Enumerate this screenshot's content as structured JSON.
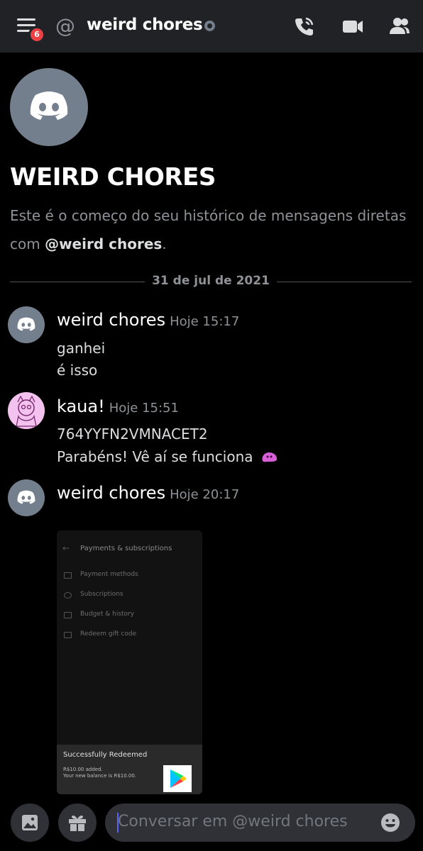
{
  "header": {
    "menu_badge": "6",
    "channel_name": "weird chores"
  },
  "intro": {
    "title": "WEIRD CHORES",
    "text_prefix": "Este é o começo do seu histórico de mensagens diretas com ",
    "mention": "@weird chores",
    "text_suffix": "."
  },
  "divider_date": "31 de jul de 2021",
  "messages": [
    {
      "author": "weird chores",
      "time": "Hoje 15:17",
      "lines": [
        "ganhei",
        "é isso"
      ]
    },
    {
      "author": "kaua!",
      "time": "Hoje 15:51",
      "lines": [
        "764YYFN2VMNACET2",
        "Parabéns! Vê aí se funciona"
      ]
    },
    {
      "author": "weird chores",
      "time": "Hoje 20:17",
      "lines": []
    }
  ],
  "attachment": {
    "title": "Payments & subscriptions",
    "items": [
      "Payment methods",
      "Subscriptions",
      "Budget & history",
      "Redeem gift code"
    ],
    "toast_title": "Successfully Redeemed",
    "toast_line1": "R$10.00 added.",
    "toast_line2": "Your new balance is R$10.00."
  },
  "composer": {
    "placeholder": "Conversar em @weird chores"
  },
  "colors": {
    "header_bg": "#202225",
    "accent": "#5865f2",
    "avatar_gray": "#747f8d",
    "badge_red": "#ed4245"
  }
}
